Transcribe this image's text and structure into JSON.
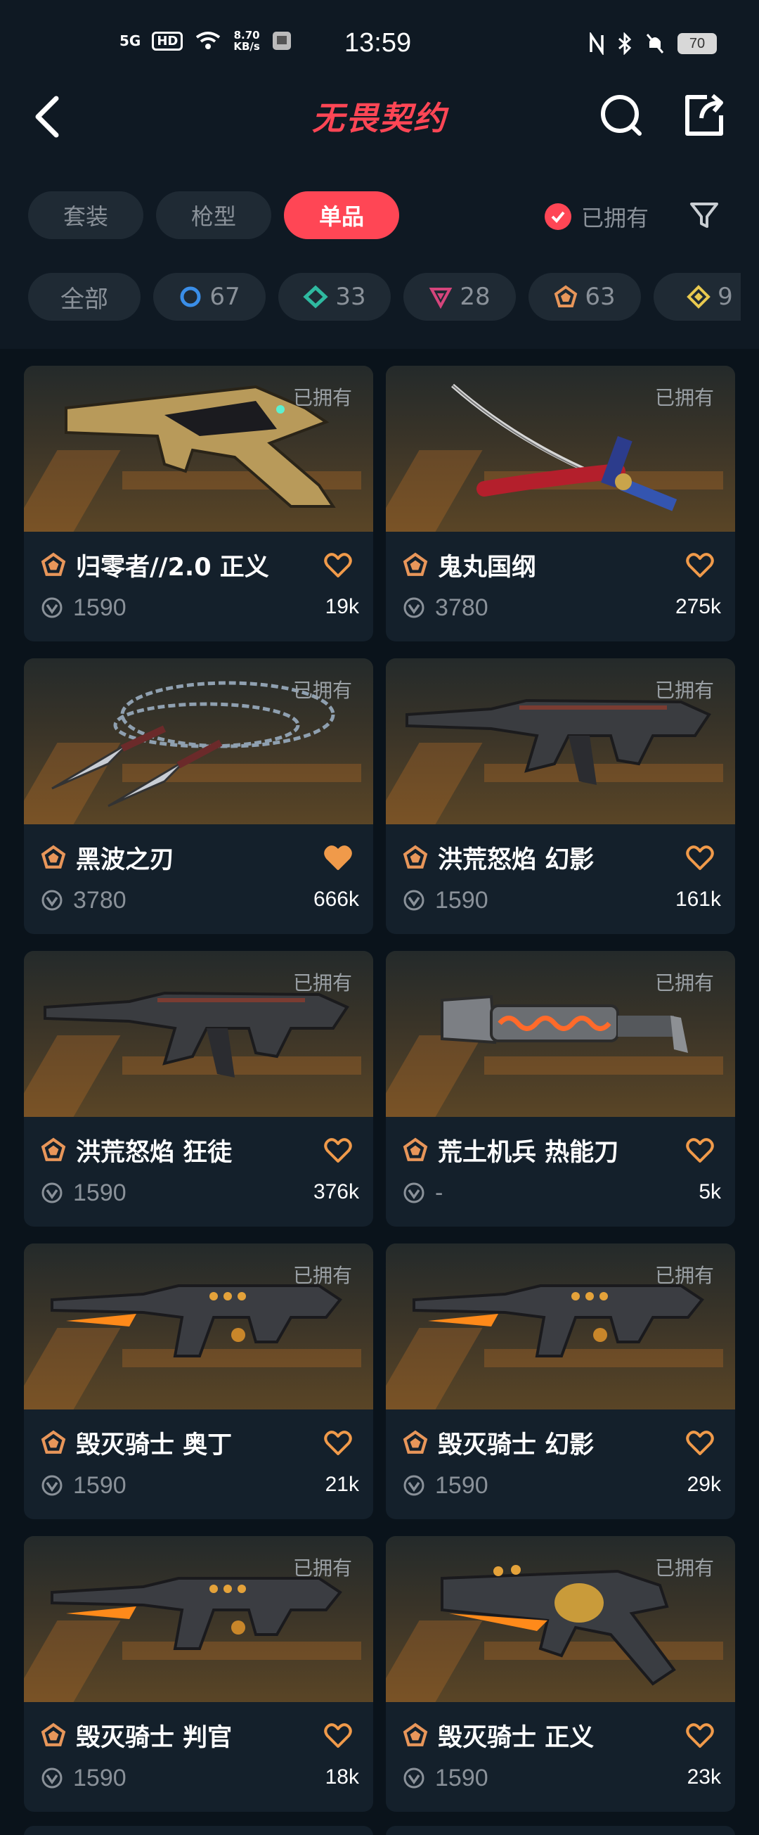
{
  "status": {
    "signal": "5G",
    "hd": "HD",
    "speed_value": "8.70",
    "speed_unit": "KB/s",
    "time": "13:59",
    "battery": "70"
  },
  "header": {
    "title": "无畏契约"
  },
  "tabs": [
    {
      "label": "套装",
      "active": false
    },
    {
      "label": "枪型",
      "active": false
    },
    {
      "label": "单品",
      "active": true
    }
  ],
  "owned_filter": {
    "label": "已拥有",
    "checked": true
  },
  "tiers": [
    {
      "label": "全部",
      "count": ""
    },
    {
      "icon": "tier-select-icon",
      "color": "#3a8ee8",
      "count": "67"
    },
    {
      "icon": "tier-deluxe-icon",
      "color": "#2fb9a0",
      "count": "33"
    },
    {
      "icon": "tier-premium-icon",
      "color": "#d5457c",
      "count": "28"
    },
    {
      "icon": "tier-exclusive-icon",
      "color": "#e8965a",
      "count": "63"
    },
    {
      "icon": "tier-ultra-icon",
      "color": "#e8c94f",
      "count": "9"
    }
  ],
  "colors": {
    "accent": "#ff4655",
    "heart": "#f09a4a",
    "tier": "#e8965a"
  },
  "items": [
    {
      "owned": "已拥有",
      "name": "归零者//2.0 正义",
      "price": "1590",
      "likes": "19k",
      "liked": false,
      "weapon": "pistol-gold"
    },
    {
      "owned": "已拥有",
      "name": "鬼丸国纲",
      "price": "3780",
      "likes": "275k",
      "liked": false,
      "weapon": "katana"
    },
    {
      "owned": "已拥有",
      "name": "黑波之刃",
      "price": "3780",
      "likes": "666k",
      "liked": true,
      "weapon": "chain-blades"
    },
    {
      "owned": "已拥有",
      "name": "洪荒怒焰 幻影",
      "price": "1590",
      "likes": "161k",
      "liked": false,
      "weapon": "rifle-dark"
    },
    {
      "owned": "已拥有",
      "name": "洪荒怒焰 狂徒",
      "price": "1590",
      "likes": "376k",
      "liked": false,
      "weapon": "rifle-dark"
    },
    {
      "owned": "已拥有",
      "name": "荒土机兵 热能刀",
      "price": "-",
      "likes": "5k",
      "liked": false,
      "weapon": "heat-knife"
    },
    {
      "owned": "已拥有",
      "name": "毁灭骑士 奥丁",
      "price": "1590",
      "likes": "21k",
      "liked": false,
      "weapon": "rifle-orange"
    },
    {
      "owned": "已拥有",
      "name": "毁灭骑士 幻影",
      "price": "1590",
      "likes": "29k",
      "liked": false,
      "weapon": "rifle-orange"
    },
    {
      "owned": "已拥有",
      "name": "毁灭骑士 判官",
      "price": "1590",
      "likes": "18k",
      "liked": false,
      "weapon": "rifle-orange"
    },
    {
      "owned": "已拥有",
      "name": "毁灭骑士 正义",
      "price": "1590",
      "likes": "23k",
      "liked": false,
      "weapon": "revolver-orange"
    }
  ]
}
